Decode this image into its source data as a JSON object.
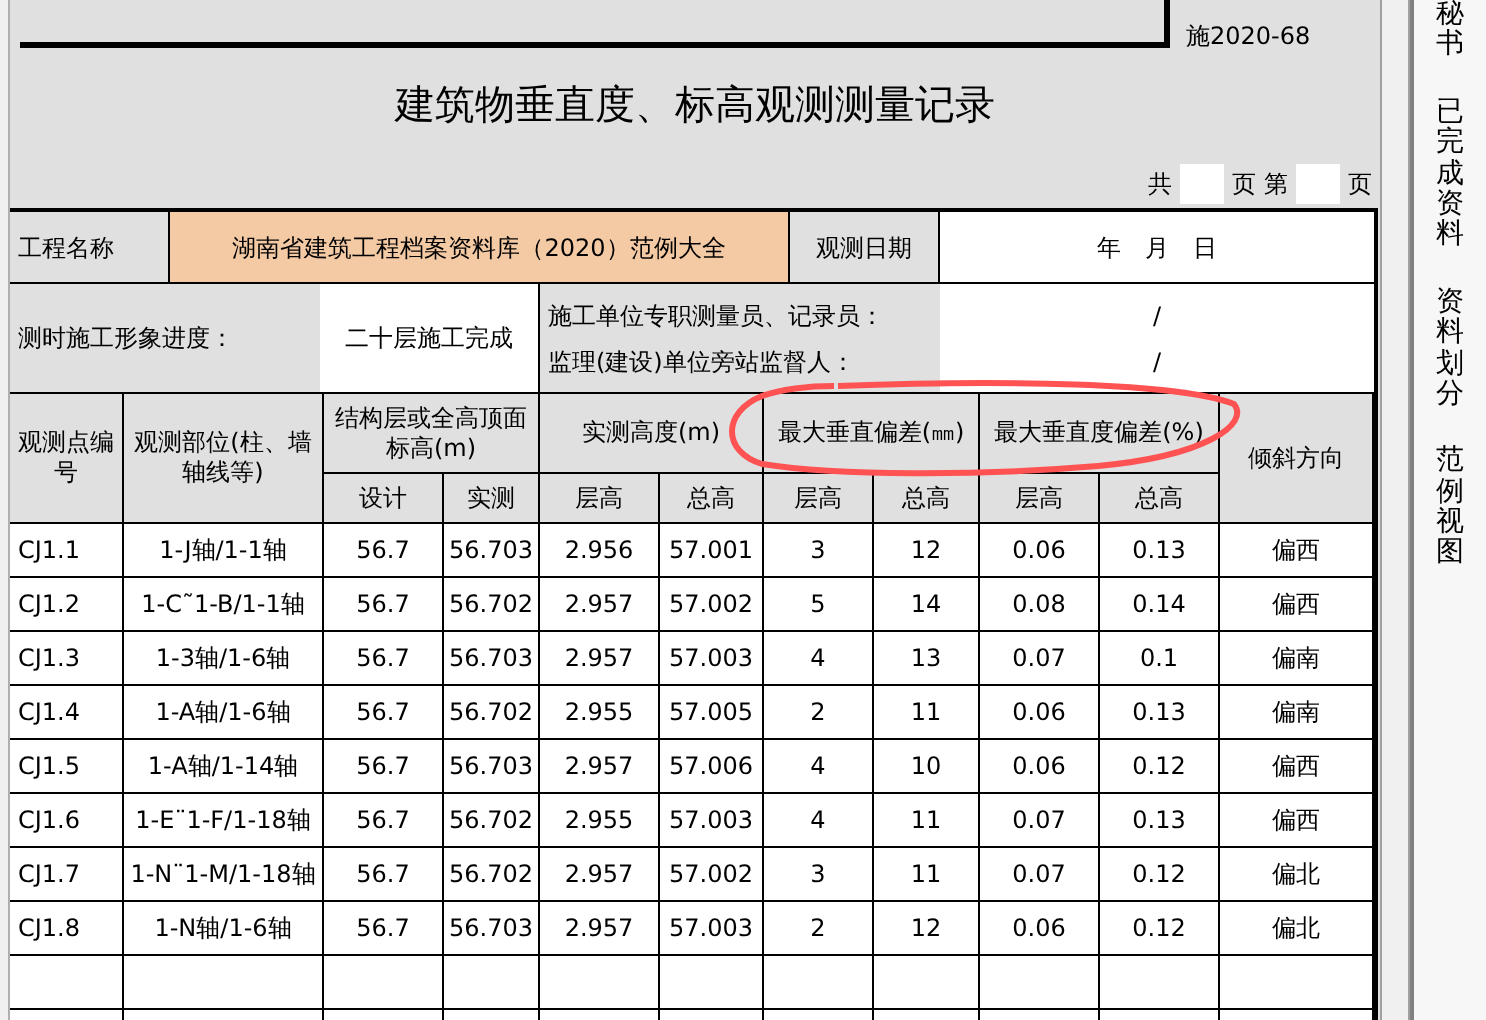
{
  "document_code": "施2020-68",
  "title": "建筑物垂直度、标高观测测量记录",
  "page_info": {
    "total_prefix": "共",
    "total_suffix": "页",
    "current_prefix": "第",
    "current_suffix": "页"
  },
  "project": {
    "label": "工程名称",
    "value": "湖南省建筑工程档案资料库（2020）范例大全",
    "date_label": "观测日期",
    "date_value": "年　月　日"
  },
  "progress": {
    "label": "测时施工形象进度：",
    "value": "二十层施工完成"
  },
  "signatures": [
    {
      "label": "施工单位专职测量员、记录员：",
      "value": "/"
    },
    {
      "label": "监理(建设)单位旁站监督人：",
      "value": "/"
    }
  ],
  "column_groups": [
    {
      "label": "观测点编号"
    },
    {
      "label": "观测部位(柱、墙轴线等)"
    },
    {
      "label": "结构层或全高顶面标高(m)",
      "sub": [
        "设计",
        "实测"
      ]
    },
    {
      "label": "实测高度(m)",
      "sub": [
        "层高",
        "总高"
      ]
    },
    {
      "label": "最大垂直偏差(㎜)",
      "sub": [
        "层高",
        "总高"
      ]
    },
    {
      "label": "最大垂直度偏差(%)",
      "sub": [
        "层高",
        "总高"
      ]
    },
    {
      "label": "倾斜方向"
    }
  ],
  "rows": [
    [
      "CJ1.1",
      "1-J轴/1-1轴",
      "56.7",
      "56.703",
      "2.956",
      "57.001",
      "3",
      "12",
      "0.06",
      "0.13",
      "偏西"
    ],
    [
      "CJ1.2",
      "1-C˜1-B/1-1轴",
      "56.7",
      "56.702",
      "2.957",
      "57.002",
      "5",
      "14",
      "0.08",
      "0.14",
      "偏西"
    ],
    [
      "CJ1.3",
      "1-3轴/1-6轴",
      "56.7",
      "56.703",
      "2.957",
      "57.003",
      "4",
      "13",
      "0.07",
      "0.1",
      "偏南"
    ],
    [
      "CJ1.4",
      "1-A轴/1-6轴",
      "56.7",
      "56.702",
      "2.955",
      "57.005",
      "2",
      "11",
      "0.06",
      "0.13",
      "偏南"
    ],
    [
      "CJ1.5",
      "1-A轴/1-14轴",
      "56.7",
      "56.703",
      "2.957",
      "57.006",
      "4",
      "10",
      "0.06",
      "0.12",
      "偏西"
    ],
    [
      "CJ1.6",
      "1-E¨1-F/1-18轴",
      "56.7",
      "56.702",
      "2.955",
      "57.003",
      "4",
      "11",
      "0.07",
      "0.13",
      "偏西"
    ],
    [
      "CJ1.7",
      "1-N¨1-M/1-18轴",
      "56.7",
      "56.702",
      "2.957",
      "57.002",
      "3",
      "11",
      "0.07",
      "0.12",
      "偏北"
    ],
    [
      "CJ1.8",
      "1-N轴/1-6轴",
      "56.7",
      "56.703",
      "2.957",
      "57.003",
      "2",
      "12",
      "0.06",
      "0.12",
      "偏北"
    ]
  ],
  "side_panel": [
    "秘书",
    "已完成资料",
    "资料划分",
    "范例视图"
  ]
}
